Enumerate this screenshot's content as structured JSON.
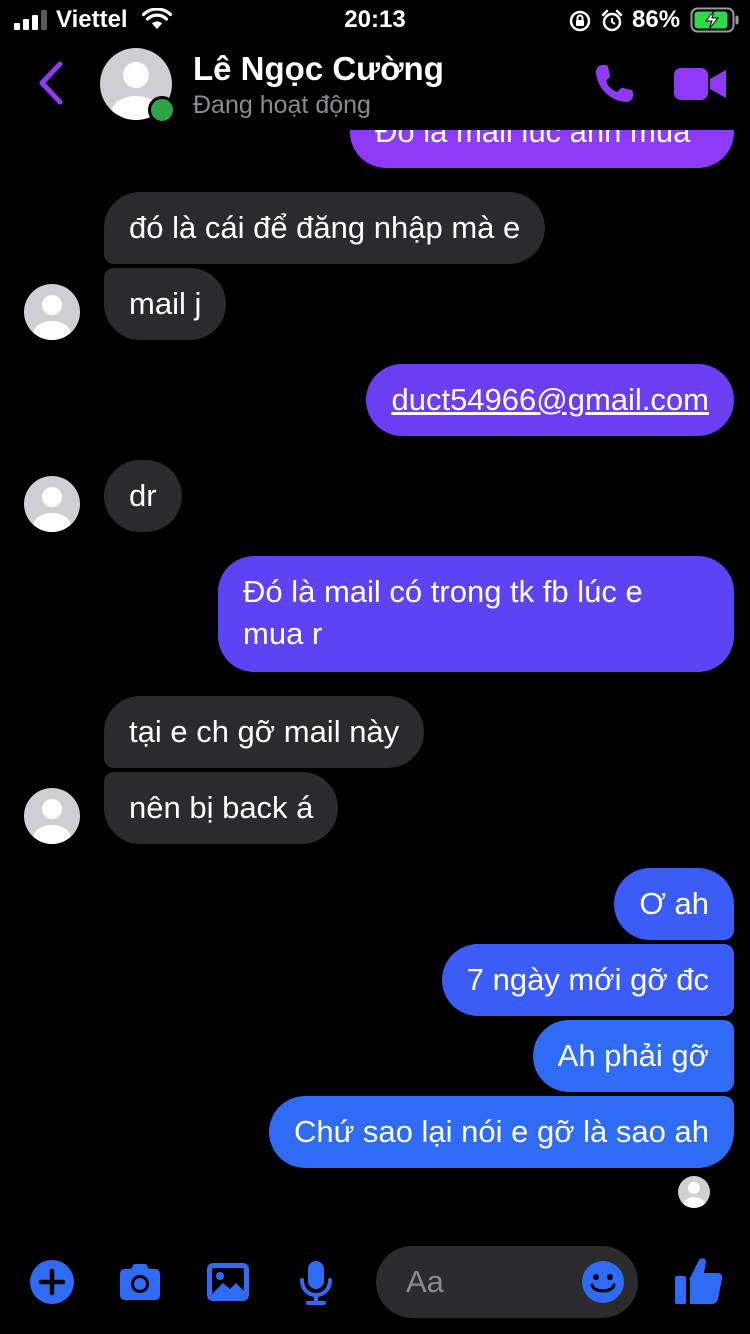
{
  "status_bar": {
    "carrier": "Viettel",
    "time": "20:13",
    "battery_pct": "86%"
  },
  "header": {
    "contact_name": "Lê Ngọc Cường",
    "contact_status": "Đang hoạt động"
  },
  "messages": [
    {
      "dir": "out",
      "text": "Đó là mail lúc anh mua"
    },
    {
      "dir": "in",
      "text": "đó là cái để đăng nhập mà e"
    },
    {
      "dir": "in",
      "text": "mail j"
    },
    {
      "dir": "out",
      "text": "duct54966@gmail.com",
      "is_link": true
    },
    {
      "dir": "in",
      "text": "dr"
    },
    {
      "dir": "out",
      "text": "Đó là mail có trong tk fb lúc e mua r"
    },
    {
      "dir": "in",
      "text": "tại e ch gỡ mail này"
    },
    {
      "dir": "in",
      "text": "nên bị back á"
    },
    {
      "dir": "out",
      "text": "Ơ ah"
    },
    {
      "dir": "out",
      "text": "7 ngày mới gỡ đc"
    },
    {
      "dir": "out",
      "text": "Ah phải gỡ"
    },
    {
      "dir": "out",
      "text": "Chứ sao lại nói e gỡ là sao ah"
    }
  ],
  "composer": {
    "placeholder": "Aa"
  },
  "colors": {
    "accent": "#8f3af6",
    "incoming_bubble": "#2b2b2d",
    "outgoing_blue": "#2f6bf5",
    "online": "#31a24c",
    "battery_green": "#32d74b"
  },
  "icons": {
    "back": "chevron-left-icon",
    "call": "phone-icon",
    "video": "video-camera-icon",
    "plus": "plus-circle-icon",
    "camera": "camera-icon",
    "gallery": "image-icon",
    "mic": "microphone-icon",
    "emoji": "smile-icon",
    "like": "thumbs-up-icon"
  }
}
